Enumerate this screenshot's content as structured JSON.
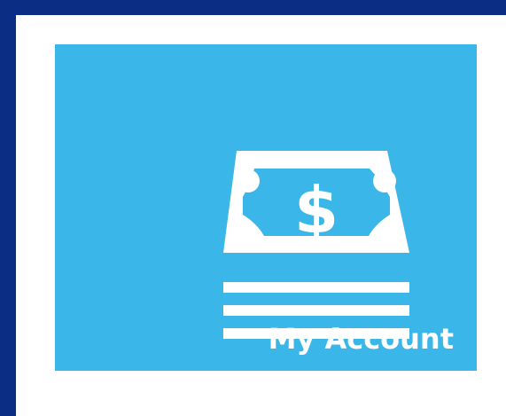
{
  "tile": {
    "label": "My Account",
    "icon": "money-stack-icon",
    "currency_symbol": "$"
  },
  "colors": {
    "outer_background": "#0b2d83",
    "frame_background": "#ffffff",
    "tile_background": "#3ab6e8",
    "icon_color": "#ffffff",
    "label_color": "#ffffff"
  }
}
